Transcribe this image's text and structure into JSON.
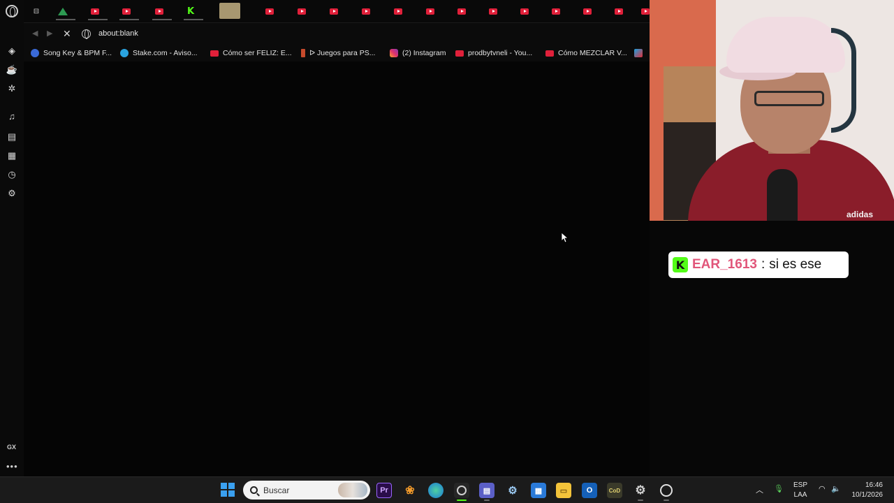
{
  "browser": {
    "url": "about:blank",
    "tabs_count": 20,
    "sidebar": {
      "gx_label": "GX",
      "more_label": "•••",
      "icons": [
        "opera-gx-icon",
        "gx-control-icon",
        "gx-cleaner-icon",
        "gx-corner-icon",
        "music-player-icon",
        "bookmarks-icon",
        "pinboards-icon",
        "history-icon",
        "settings-icon"
      ]
    },
    "bookmarks": [
      {
        "label": "Song Key & BPM F...",
        "icon": "music"
      },
      {
        "label": "Stake.com - Aviso...",
        "icon": "telegram"
      },
      {
        "label": "Cómo ser FELIZ: E...",
        "icon": "yt"
      },
      {
        "label": "ᐅ Juegos para PS...",
        "icon": "pin"
      },
      {
        "label": "(2) Instagram",
        "icon": "ig"
      },
      {
        "label": "prodbytvneli - You...",
        "icon": "yt"
      },
      {
        "label": "Cómo MEZCLAR V...",
        "icon": "yt"
      },
      {
        "label": "",
        "icon": "mix"
      }
    ]
  },
  "chat": {
    "badge": "K",
    "username": "EAR_1613",
    "separator": ":",
    "message": "si es ese",
    "username_color": "#e1567a"
  },
  "webcam": {
    "shirt_logo": "adidas"
  },
  "taskbar": {
    "search_placeholder": "Buscar",
    "apps": [
      "premiere-pro",
      "fl-studio",
      "edge",
      "opera-gx",
      "teams",
      "steam",
      "microsoft-store",
      "file-explorer",
      "outlook",
      "call-of-duty",
      "settings",
      "obs"
    ],
    "premiere_label": "Pr",
    "language_line1": "ESP",
    "language_line2": "LAA",
    "time": "16:46",
    "date": "10/1/2026"
  },
  "colors": {
    "kick_green": "#53fc18",
    "youtube_red": "#e0203a",
    "windows_blue": "#3aa0f0"
  }
}
